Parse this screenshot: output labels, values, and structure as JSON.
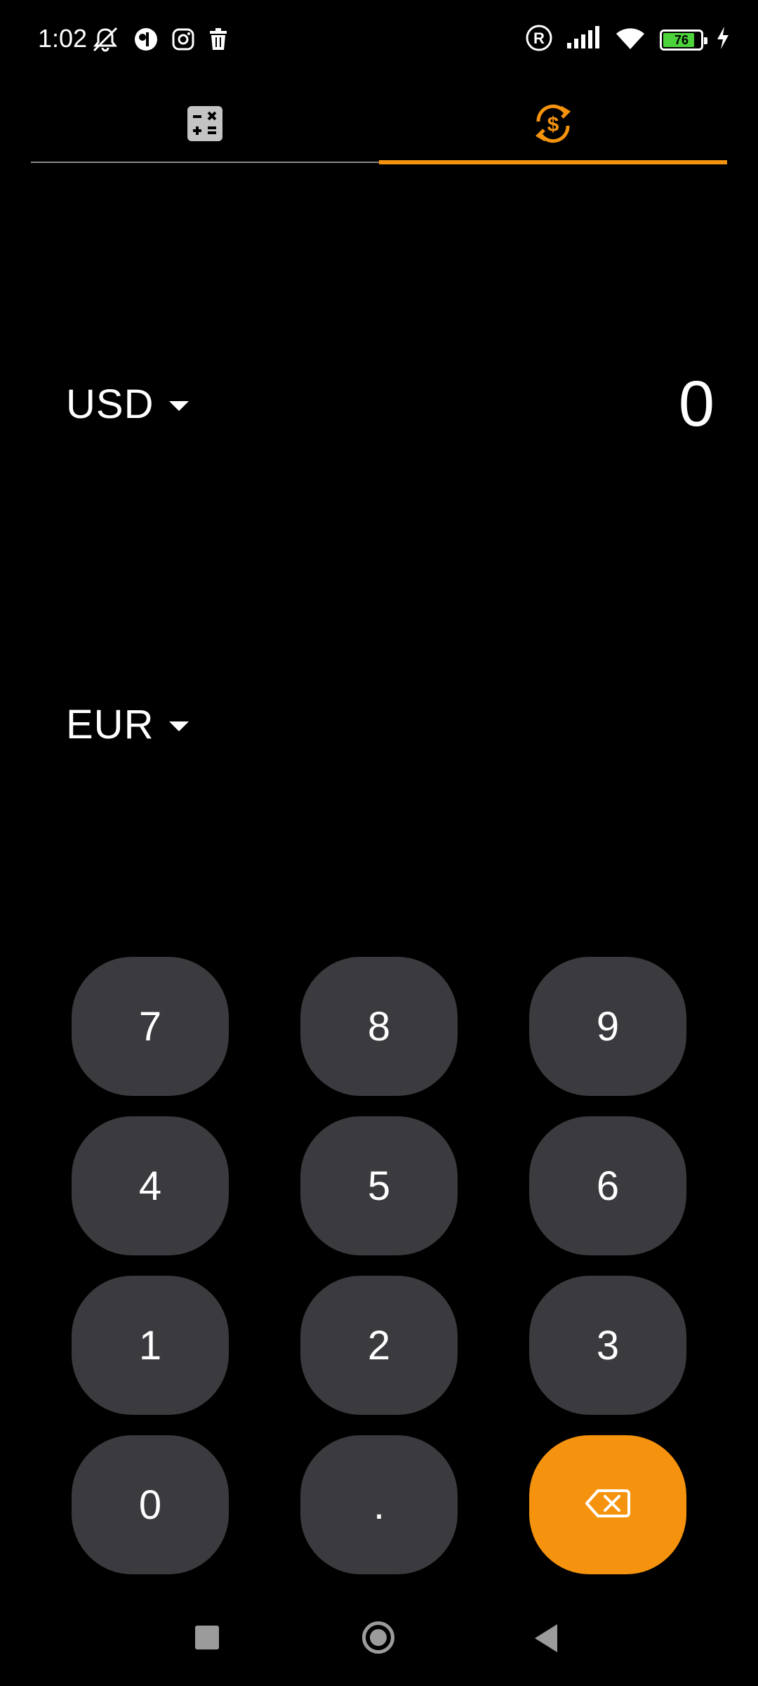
{
  "status_bar": {
    "time": "1:02",
    "battery_level": "76",
    "left_icons": [
      "mute-icon",
      "app-notification-icon",
      "instagram-icon",
      "trash-icon"
    ],
    "right_icons": [
      "registered-icon",
      "signal-icon",
      "wifi-icon",
      "battery-icon",
      "charging-icon"
    ]
  },
  "tabs": [
    {
      "icon": "calculator-icon",
      "active": false
    },
    {
      "icon": "currency-exchange-icon",
      "active": true
    }
  ],
  "converter": {
    "from": {
      "currency": "USD",
      "value": "0"
    },
    "to": {
      "currency": "EUR",
      "value": ""
    }
  },
  "keypad": {
    "keys": [
      "7",
      "8",
      "9",
      "4",
      "5",
      "6",
      "1",
      "2",
      "3",
      "0",
      "."
    ],
    "backspace_icon": "backspace-icon"
  },
  "colors": {
    "accent": "#f5930e",
    "key_background": "#3b3b3f",
    "background": "#000000"
  }
}
